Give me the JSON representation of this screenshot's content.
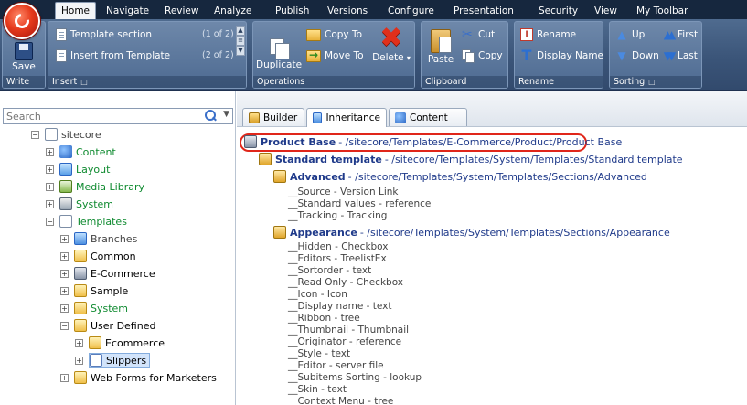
{
  "menu": {
    "tabs": [
      "Home",
      "Navigate",
      "Review",
      "Analyze",
      "Publish",
      "Versions",
      "Configure",
      "Presentation",
      "Security",
      "View",
      "My Toolbar"
    ],
    "active": "Home"
  },
  "ribbon": {
    "write": {
      "save": "Save",
      "label": "Write"
    },
    "insert": {
      "label": "Insert",
      "items": [
        {
          "text": "Template section",
          "count": "(1 of 2)"
        },
        {
          "text": "Insert from Template",
          "count": "(2 of 2)"
        }
      ]
    },
    "operations": {
      "label": "Operations",
      "duplicate": "Duplicate",
      "copy_to": "Copy To",
      "move_to": "Move To",
      "delete": "Delete"
    },
    "clipboard": {
      "label": "Clipboard",
      "paste": "Paste",
      "cut": "Cut",
      "copy": "Copy"
    },
    "rename": {
      "label": "Rename",
      "rename": "Rename",
      "display_name": "Display Name"
    },
    "sorting": {
      "label": "Sorting",
      "up": "Up",
      "down": "Down",
      "first": "First",
      "last": "Last"
    }
  },
  "search": {
    "placeholder": "Search"
  },
  "tree": {
    "sitecore": "sitecore",
    "content": "Content",
    "layout": "Layout",
    "media_library": "Media Library",
    "system": "System",
    "templates": "Templates",
    "branches": "Branches",
    "common": "Common",
    "ecommerce": "E-Commerce",
    "sample": "Sample",
    "system2": "System",
    "user_defined": "User Defined",
    "ecommerce2": "Ecommerce",
    "slippers": "Slippers",
    "webforms": "Web Forms for Marketers"
  },
  "editor_tabs": [
    "Builder",
    "Inheritance",
    "Content"
  ],
  "inheritance": {
    "product_base": {
      "name": "Product Base",
      "path": " - /sitecore/Templates/E-Commerce/Product/Product Base"
    },
    "standard": {
      "name": "Standard template",
      "path": " - /sitecore/Templates/System/Templates/Standard template"
    },
    "advanced": {
      "name": "Advanced",
      "path": " - /sitecore/Templates/System/Templates/Sections/Advanced",
      "fields": [
        "__Source - Version Link",
        "__Standard values - reference",
        "__Tracking - Tracking"
      ]
    },
    "appearance": {
      "name": "Appearance",
      "path": " - /sitecore/Templates/System/Templates/Sections/Appearance",
      "fields": [
        "__Hidden - Checkbox",
        "__Editors - TreelistEx",
        "__Sortorder - text",
        "__Read Only - Checkbox",
        "__Icon - Icon",
        "__Display name - text",
        "__Ribbon - tree",
        "__Thumbnail - Thumbnail",
        "__Originator - reference",
        "__Style - text",
        "__Editor - server file",
        "__Subitems Sorting - lookup",
        "__Skin - text",
        "__Context Menu - tree"
      ]
    }
  },
  "colors": {
    "accent_red": "#e0261a",
    "link_blue": "#1f3a8a",
    "tree_green": "#0e8a2f",
    "ribbon_blue": "#3b5579"
  }
}
